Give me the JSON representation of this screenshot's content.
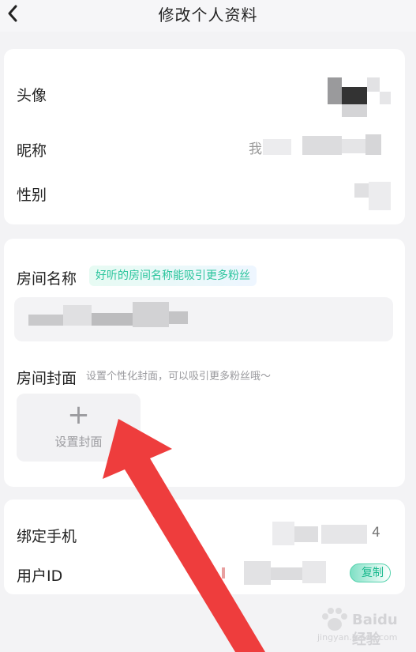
{
  "header": {
    "title": "修改个人资料",
    "back_icon": "chevron-left-icon"
  },
  "profile": {
    "avatar_label": "头像",
    "nickname_label": "昵称",
    "nickname_partial": "我",
    "gender_label": "性别"
  },
  "room": {
    "name_label": "房间名称",
    "name_hint": "好听的房间名称能吸引更多粉丝",
    "cover_label": "房间封面",
    "cover_hint": "设置个性化封面，可以吸引更多粉丝哦～",
    "cover_button_plus": "+",
    "cover_button_label": "设置封面"
  },
  "account": {
    "phone_label": "绑定手机",
    "phone_tail": "4",
    "user_id_label": "用户ID",
    "copy_button": "复制"
  },
  "watermark": {
    "brand": "Baidu经验",
    "url": "jingyan.baidu.com"
  },
  "colors": {
    "accent": "#2cc59d",
    "arrow": "#ee3d3d",
    "background": "#f3f3f5"
  }
}
